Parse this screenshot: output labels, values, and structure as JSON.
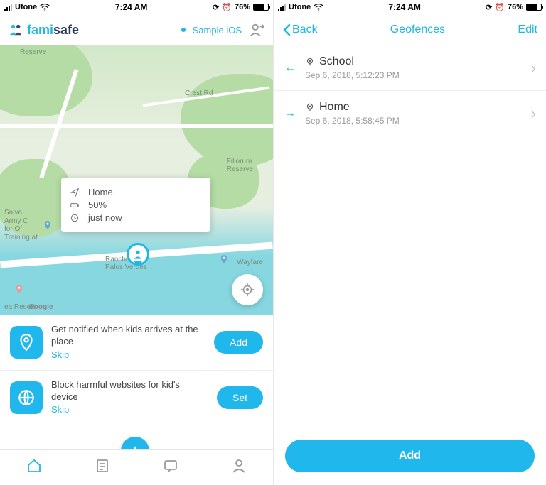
{
  "status": {
    "carrier": "Ufone",
    "time": "7:24 AM",
    "battery": "76%"
  },
  "left": {
    "logo_fami": "fami",
    "logo_safe": "safe",
    "device": "Sample iOS",
    "map": {
      "labels": {
        "reserve": "Reserve",
        "crest": "Crest Rd",
        "filiorum": "Filiorum\nReserve",
        "salva": "Salva\nArmy C\nfor Of\nTraining at",
        "rancho": "Rancho\nPalos Verdes",
        "wayfare": "Wayfare",
        "resort": "ea Resort",
        "google": "Google"
      },
      "popup": {
        "place": "Home",
        "battery": "50%",
        "when": "just now"
      }
    },
    "cards": [
      {
        "text": "Get notified when kids arrives at the place",
        "skip": "Skip",
        "action": "Add"
      },
      {
        "text": "Block harmful websites for kid's device",
        "skip": "Skip",
        "action": "Set"
      }
    ]
  },
  "right": {
    "back": "Back",
    "title": "Geofences",
    "edit": "Edit",
    "items": [
      {
        "dir": "enter",
        "name": "School",
        "ts": "Sep 6, 2018, 5:12:23 PM"
      },
      {
        "dir": "leave",
        "name": "Home",
        "ts": "Sep 6, 2018, 5:58:45 PM"
      }
    ],
    "add": "Add"
  }
}
